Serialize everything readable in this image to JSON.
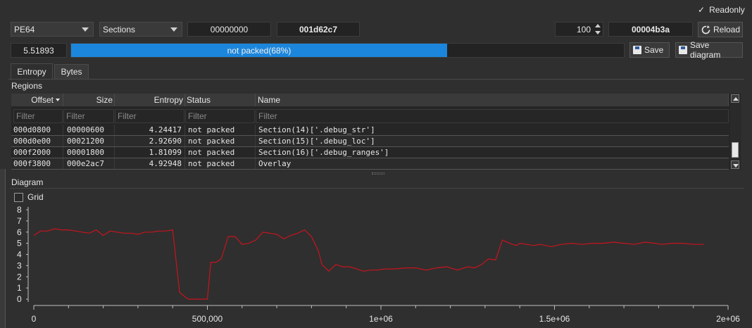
{
  "toolbar": {
    "readonly_label": "Readonly",
    "readonly_checked": true,
    "file_type": "PE64",
    "mode": "Sections",
    "offset_start": "00000000",
    "offset_end": "001d62c7",
    "block_count": "100",
    "block_size": "00004b3a",
    "reload_label": "Reload"
  },
  "status": {
    "entropy_value": "5.51893",
    "progress_label": "not packed(68%)",
    "progress_fraction": 0.68,
    "save_label": "Save",
    "save_diagram_label": "Save diagram"
  },
  "tabs": [
    "Entropy",
    "Bytes"
  ],
  "regions": {
    "title": "Regions",
    "columns": [
      "Offset",
      "Size",
      "Entropy",
      "Status",
      "Name"
    ],
    "filter_placeholder": "Filter",
    "rows": [
      [
        "000d0800",
        "00000600",
        "4.24417",
        "not packed",
        "Section(14)['.debug_str']"
      ],
      [
        "000d0e00",
        "00021200",
        "2.92690",
        "not packed",
        "Section(15)['.debug_loc']"
      ],
      [
        "000f2000",
        "00001800",
        "1.81099",
        "not packed",
        "Section(16)['.debug_ranges']"
      ],
      [
        "000f3800",
        "000e2ac7",
        "4.92948",
        "not packed",
        "Overlay"
      ]
    ]
  },
  "diagram": {
    "title": "Diagram",
    "grid_label": "Grid",
    "grid_checked": false
  },
  "chart_data": {
    "type": "line",
    "title": "",
    "xlabel": "",
    "ylabel": "",
    "xlim": [
      0,
      2000000
    ],
    "ylim": [
      0,
      8
    ],
    "x_ticks": [
      0,
      500000,
      1000000,
      1500000,
      2000000
    ],
    "x_tick_labels": [
      "0",
      "500,000",
      "1e+06",
      "1.5e+06",
      "2e+06"
    ],
    "y_ticks": [
      0,
      1,
      2,
      3,
      4,
      5,
      6,
      7,
      8
    ],
    "y_tick_labels": [
      "0",
      "1",
      "2",
      "3",
      "4",
      "5",
      "6",
      "7",
      "8"
    ],
    "line_color": "#c8141e",
    "series": [
      {
        "name": "",
        "x": [
          0,
          20000,
          40000,
          60000,
          80000,
          100000,
          120000,
          140000,
          160000,
          180000,
          200000,
          220000,
          240000,
          260000,
          280000,
          300000,
          320000,
          340000,
          360000,
          380000,
          400000,
          420000,
          440000,
          445000,
          465000,
          480000,
          500000,
          510000,
          525000,
          540000,
          560000,
          580000,
          600000,
          620000,
          640000,
          660000,
          680000,
          700000,
          720000,
          740000,
          760000,
          780000,
          800000,
          820000,
          830000,
          850000,
          870000,
          890000,
          910000,
          930000,
          950000,
          970000,
          990000,
          1010000,
          1040000,
          1070000,
          1100000,
          1130000,
          1160000,
          1190000,
          1220000,
          1250000,
          1270000,
          1290000,
          1310000,
          1330000,
          1350000,
          1370000,
          1390000,
          1400000,
          1420000,
          1440000,
          1460000,
          1490000,
          1520000,
          1550000,
          1580000,
          1610000,
          1640000,
          1670000,
          1700000,
          1730000,
          1760000,
          1790000,
          1810000,
          1840000,
          1870000,
          1900000,
          1930000
        ],
        "y": [
          5.7,
          6.1,
          6.1,
          6.3,
          6.2,
          6.2,
          6.1,
          6.0,
          5.9,
          6.2,
          5.7,
          6.1,
          6.0,
          5.9,
          5.9,
          5.8,
          6.0,
          6.0,
          6.1,
          6.1,
          6.2,
          0.6,
          0.1,
          0.0,
          0.0,
          0.0,
          0.0,
          3.3,
          3.3,
          3.6,
          5.6,
          5.6,
          4.9,
          5.0,
          5.3,
          6.0,
          5.9,
          5.8,
          5.4,
          5.7,
          5.9,
          6.2,
          5.6,
          4.3,
          3.1,
          2.5,
          3.1,
          2.9,
          2.9,
          2.7,
          2.5,
          2.6,
          2.6,
          2.7,
          2.7,
          2.8,
          2.8,
          2.6,
          2.8,
          2.9,
          2.6,
          2.9,
          2.8,
          3.1,
          3.6,
          3.5,
          5.3,
          5.0,
          4.8,
          5.0,
          4.9,
          4.8,
          4.9,
          4.7,
          4.9,
          5.0,
          4.9,
          5.0,
          5.0,
          5.1,
          5.0,
          4.9,
          5.1,
          5.0,
          4.9,
          5.0,
          5.0,
          4.9,
          4.9
        ]
      }
    ]
  }
}
